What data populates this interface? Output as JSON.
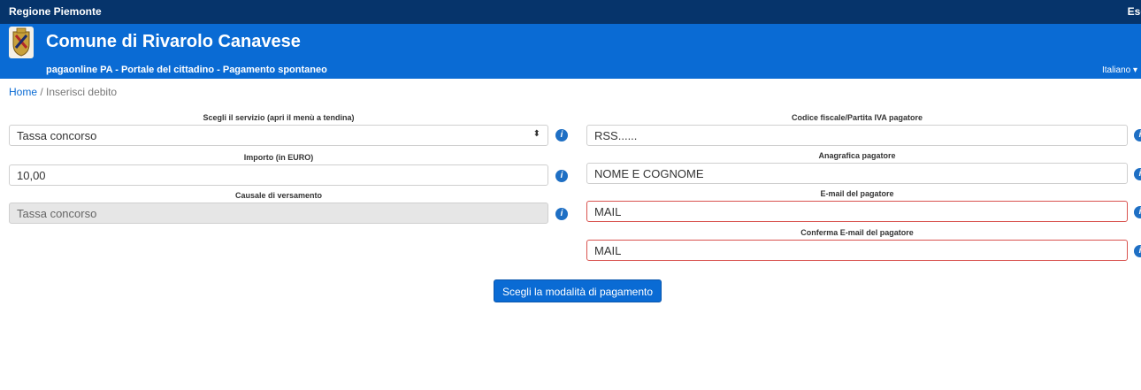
{
  "topbar": {
    "region": "Regione Piemonte",
    "exit": "Esc"
  },
  "header": {
    "title": "Comune di Rivarolo Canavese",
    "subtitle": "pagaonline PA - Portale del cittadino - Pagamento spontaneo",
    "language": "Italiano ▾"
  },
  "breadcrumb": {
    "home": "Home",
    "separator": "/",
    "current": "Inserisci debito"
  },
  "left": {
    "service": {
      "label": "Scegli il servizio (apri il menù a tendina)",
      "value": "Tassa concorso",
      "arrow": "⬍"
    },
    "amount": {
      "label": "Importo (in EURO)",
      "value": "10,00"
    },
    "reason": {
      "label": "Causale di versamento",
      "value": "Tassa concorso"
    }
  },
  "right": {
    "taxcode": {
      "label": "Codice fiscale/Partita IVA pagatore",
      "value": "RSS......"
    },
    "name": {
      "label": "Anagrafica pagatore",
      "value": "NOME E COGNOME"
    },
    "email": {
      "label": "E-mail del pagatore",
      "value": "MAIL"
    },
    "email_confirm": {
      "label": "Conferma E-mail del pagatore",
      "value": "MAIL"
    }
  },
  "info_icon": "i",
  "submit_label": "Scegli la modalità di pagamento",
  "colors": {
    "topbar": "#06346b",
    "header": "#0a6bd4",
    "error": "#d9534f"
  }
}
